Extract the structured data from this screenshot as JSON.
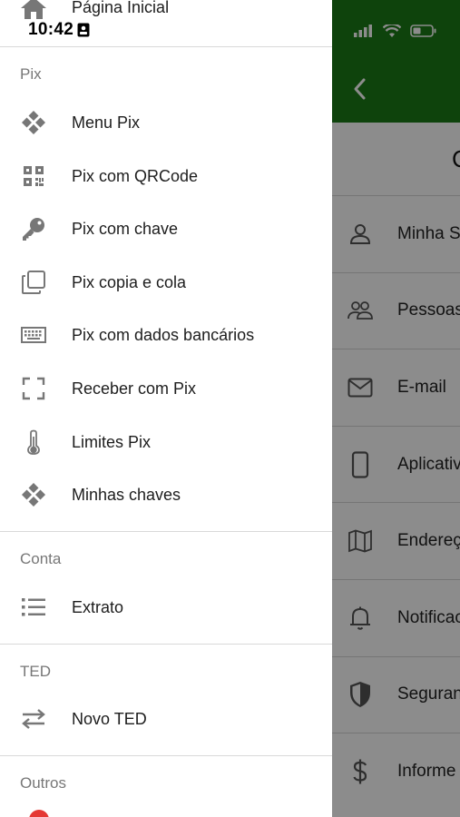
{
  "status_bar": {
    "time": "10:42"
  },
  "drawer": {
    "home": {
      "label": "Página Inicial",
      "icon": "home-icon"
    },
    "sections": [
      {
        "title": "Pix",
        "items": [
          {
            "label": "Menu Pix",
            "icon": "pix-icon"
          },
          {
            "label": "Pix com QRCode",
            "icon": "qrcode-icon"
          },
          {
            "label": "Pix com chave",
            "icon": "key-icon"
          },
          {
            "label": "Pix copia e cola",
            "icon": "copy-icon"
          },
          {
            "label": "Pix com dados bancários",
            "icon": "keyboard-icon"
          },
          {
            "label": "Receber com Pix",
            "icon": "scan-frame-icon"
          },
          {
            "label": "Limites Pix",
            "icon": "thermometer-icon"
          },
          {
            "label": "Minhas chaves",
            "icon": "pix-icon"
          }
        ]
      },
      {
        "title": "Conta",
        "items": [
          {
            "label": "Extrato",
            "icon": "list-icon"
          }
        ]
      },
      {
        "title": "TED",
        "items": [
          {
            "label": "Novo TED",
            "icon": "transfer-arrows-icon"
          }
        ]
      },
      {
        "title": "Outros",
        "items": []
      }
    ]
  },
  "background_screen": {
    "header_color": "#1a7a16",
    "title_fragment": "C",
    "rows": [
      {
        "label": "Minha S",
        "icon": "person-icon"
      },
      {
        "label": "Pessoas",
        "icon": "people-icon"
      },
      {
        "label": "E-mail",
        "icon": "mail-icon"
      },
      {
        "label": "Aplicativ",
        "icon": "phone-icon"
      },
      {
        "label": "Endereç",
        "icon": "map-icon"
      },
      {
        "label": "Notificac",
        "icon": "bell-icon"
      },
      {
        "label": "Seguran",
        "icon": "shield-icon"
      },
      {
        "label": "Informe",
        "icon": "dollar-icon"
      }
    ]
  }
}
